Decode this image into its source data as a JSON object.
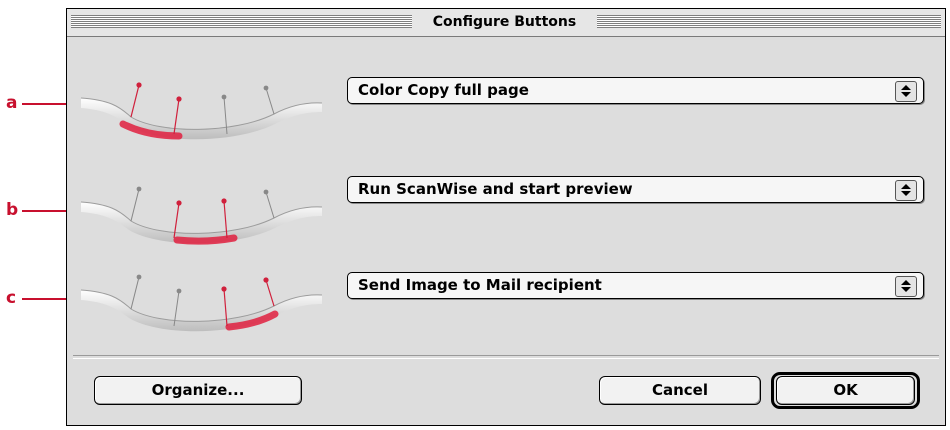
{
  "window": {
    "title": "Configure Buttons"
  },
  "callouts": [
    {
      "letter": "a"
    },
    {
      "letter": "b"
    },
    {
      "letter": "c"
    }
  ],
  "rows": [
    {
      "thumbnail_icon": "scanner-button-1-highlighted-icon",
      "selected_action": "Color Copy full page"
    },
    {
      "thumbnail_icon": "scanner-button-2-highlighted-icon",
      "selected_action": "Run ScanWise and start preview"
    },
    {
      "thumbnail_icon": "scanner-button-3-highlighted-icon",
      "selected_action": "Send Image to Mail recipient"
    }
  ],
  "buttons": {
    "organize": "Organize...",
    "cancel": "Cancel",
    "ok": "OK"
  },
  "colors": {
    "callout": "#c8102e",
    "highlight": "#e02040",
    "window_bg": "#dddddd"
  }
}
